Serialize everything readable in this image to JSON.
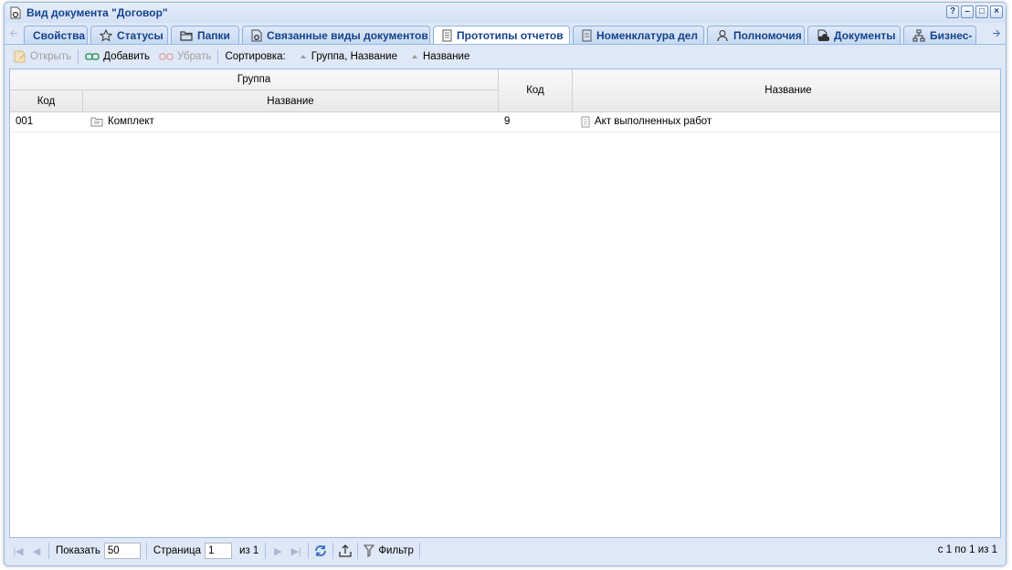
{
  "window": {
    "title": "Вид документа \"Договор\"",
    "tools": [
      "?",
      "–",
      "□",
      "×"
    ]
  },
  "tabs": [
    {
      "label": "Свойства",
      "icon": "none"
    },
    {
      "label": "Статусы",
      "icon": "star-icon"
    },
    {
      "label": "Папки",
      "icon": "folder-icon"
    },
    {
      "label": "Связанные виды документов",
      "icon": "doc-gear-icon"
    },
    {
      "label": "Прототипы отчетов",
      "icon": "report-icon",
      "active": true
    },
    {
      "label": "Номенклатура дел",
      "icon": "archive-icon"
    },
    {
      "label": "Полномочия",
      "icon": "user-key-icon"
    },
    {
      "label": "Документы",
      "icon": "document-cloud-icon"
    },
    {
      "label": "Бизнес-",
      "icon": "sitemap-icon"
    }
  ],
  "toolbar": {
    "open_label": "Открыть",
    "add_label": "Добавить",
    "remove_label": "Убрать",
    "sort_label": "Сортировка:",
    "sort1_label": "Группа, Название",
    "sort2_label": "Название"
  },
  "grid": {
    "group_header": "Группа",
    "group_code_header": "Код",
    "group_name_header": "Название",
    "code_header": "Код",
    "name_header": "Название",
    "rows": [
      {
        "group_code": "001",
        "group_name": "Комплект",
        "code": "9",
        "name": "Акт выполненных работ"
      }
    ]
  },
  "pager": {
    "show_label": "Показать",
    "page_size": "50",
    "page_label": "Страница",
    "page_value": "1",
    "of_label": "из 1",
    "filter_label": "Фильтр",
    "info": "с 1 по 1 из 1"
  },
  "colors": {
    "accent": "#15428b",
    "frame": "#dfe8f6",
    "border": "#99bbe8"
  }
}
